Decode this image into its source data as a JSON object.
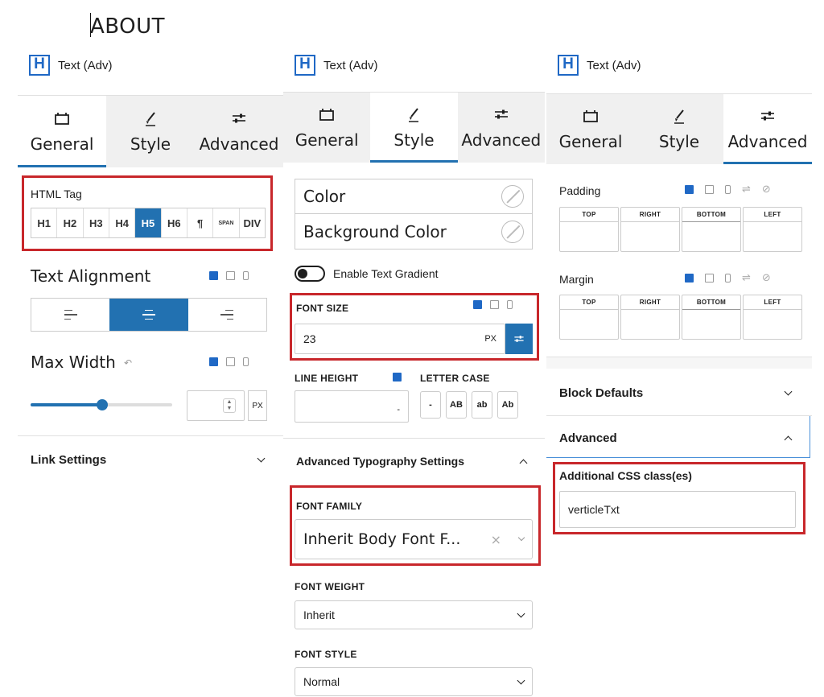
{
  "page": {
    "heading": "ABOUT"
  },
  "block": {
    "icon_letter": "H",
    "name": "Text (Adv)"
  },
  "tabs": {
    "general": "General",
    "style": "Style",
    "advanced": "Advanced"
  },
  "general_panel": {
    "html_tag_label": "HTML Tag",
    "html_tags": [
      "H1",
      "H2",
      "H3",
      "H4",
      "H5",
      "H6",
      "¶",
      "SPAN",
      "DIV"
    ],
    "html_tag_selected": "H5",
    "text_alignment_label": "Text Alignment",
    "max_width_label": "Max Width",
    "max_width_unit": "PX",
    "link_settings_label": "Link Settings"
  },
  "style_panel": {
    "color_label": "Color",
    "background_color_label": "Background Color",
    "text_gradient_label": "Enable Text Gradient",
    "font_size_label": "FONT SIZE",
    "font_size_value": "23",
    "font_size_unit": "PX",
    "line_height_label": "LINE HEIGHT",
    "line_height_unit": "-",
    "letter_case_label": "LETTER CASE",
    "letter_case_options": [
      "-",
      "AB",
      "ab",
      "Ab"
    ],
    "adv_typo_label": "Advanced Typography Settings",
    "font_family_label": "FONT FAMILY",
    "font_family_value": "Inherit Body Font F...",
    "font_family_clear": "×",
    "font_weight_label": "FONT WEIGHT",
    "font_weight_value": "Inherit",
    "font_style_label": "FONT STYLE",
    "font_style_value": "Normal"
  },
  "advanced_panel": {
    "padding_label": "Padding",
    "margin_label": "Margin",
    "sides": [
      "TOP",
      "RIGHT",
      "BOTTOM",
      "LEFT"
    ],
    "block_defaults_label": "Block Defaults",
    "advanced_label": "Advanced",
    "css_class_label": "Additional CSS class(es)",
    "css_class_value": "verticleTxt"
  },
  "colors": {
    "accent": "#2271b1",
    "highlight": "#c8272b",
    "tab_bg": "#f0f0f0"
  },
  "icons": [
    "block-h-icon",
    "layout-icon",
    "brush-icon",
    "sliders-icon",
    "desktop-icon",
    "tablet-icon",
    "mobile-icon",
    "clear-color-icon",
    "reset-icon",
    "link-icon",
    "chevron-down-icon",
    "chevron-up-icon"
  ]
}
